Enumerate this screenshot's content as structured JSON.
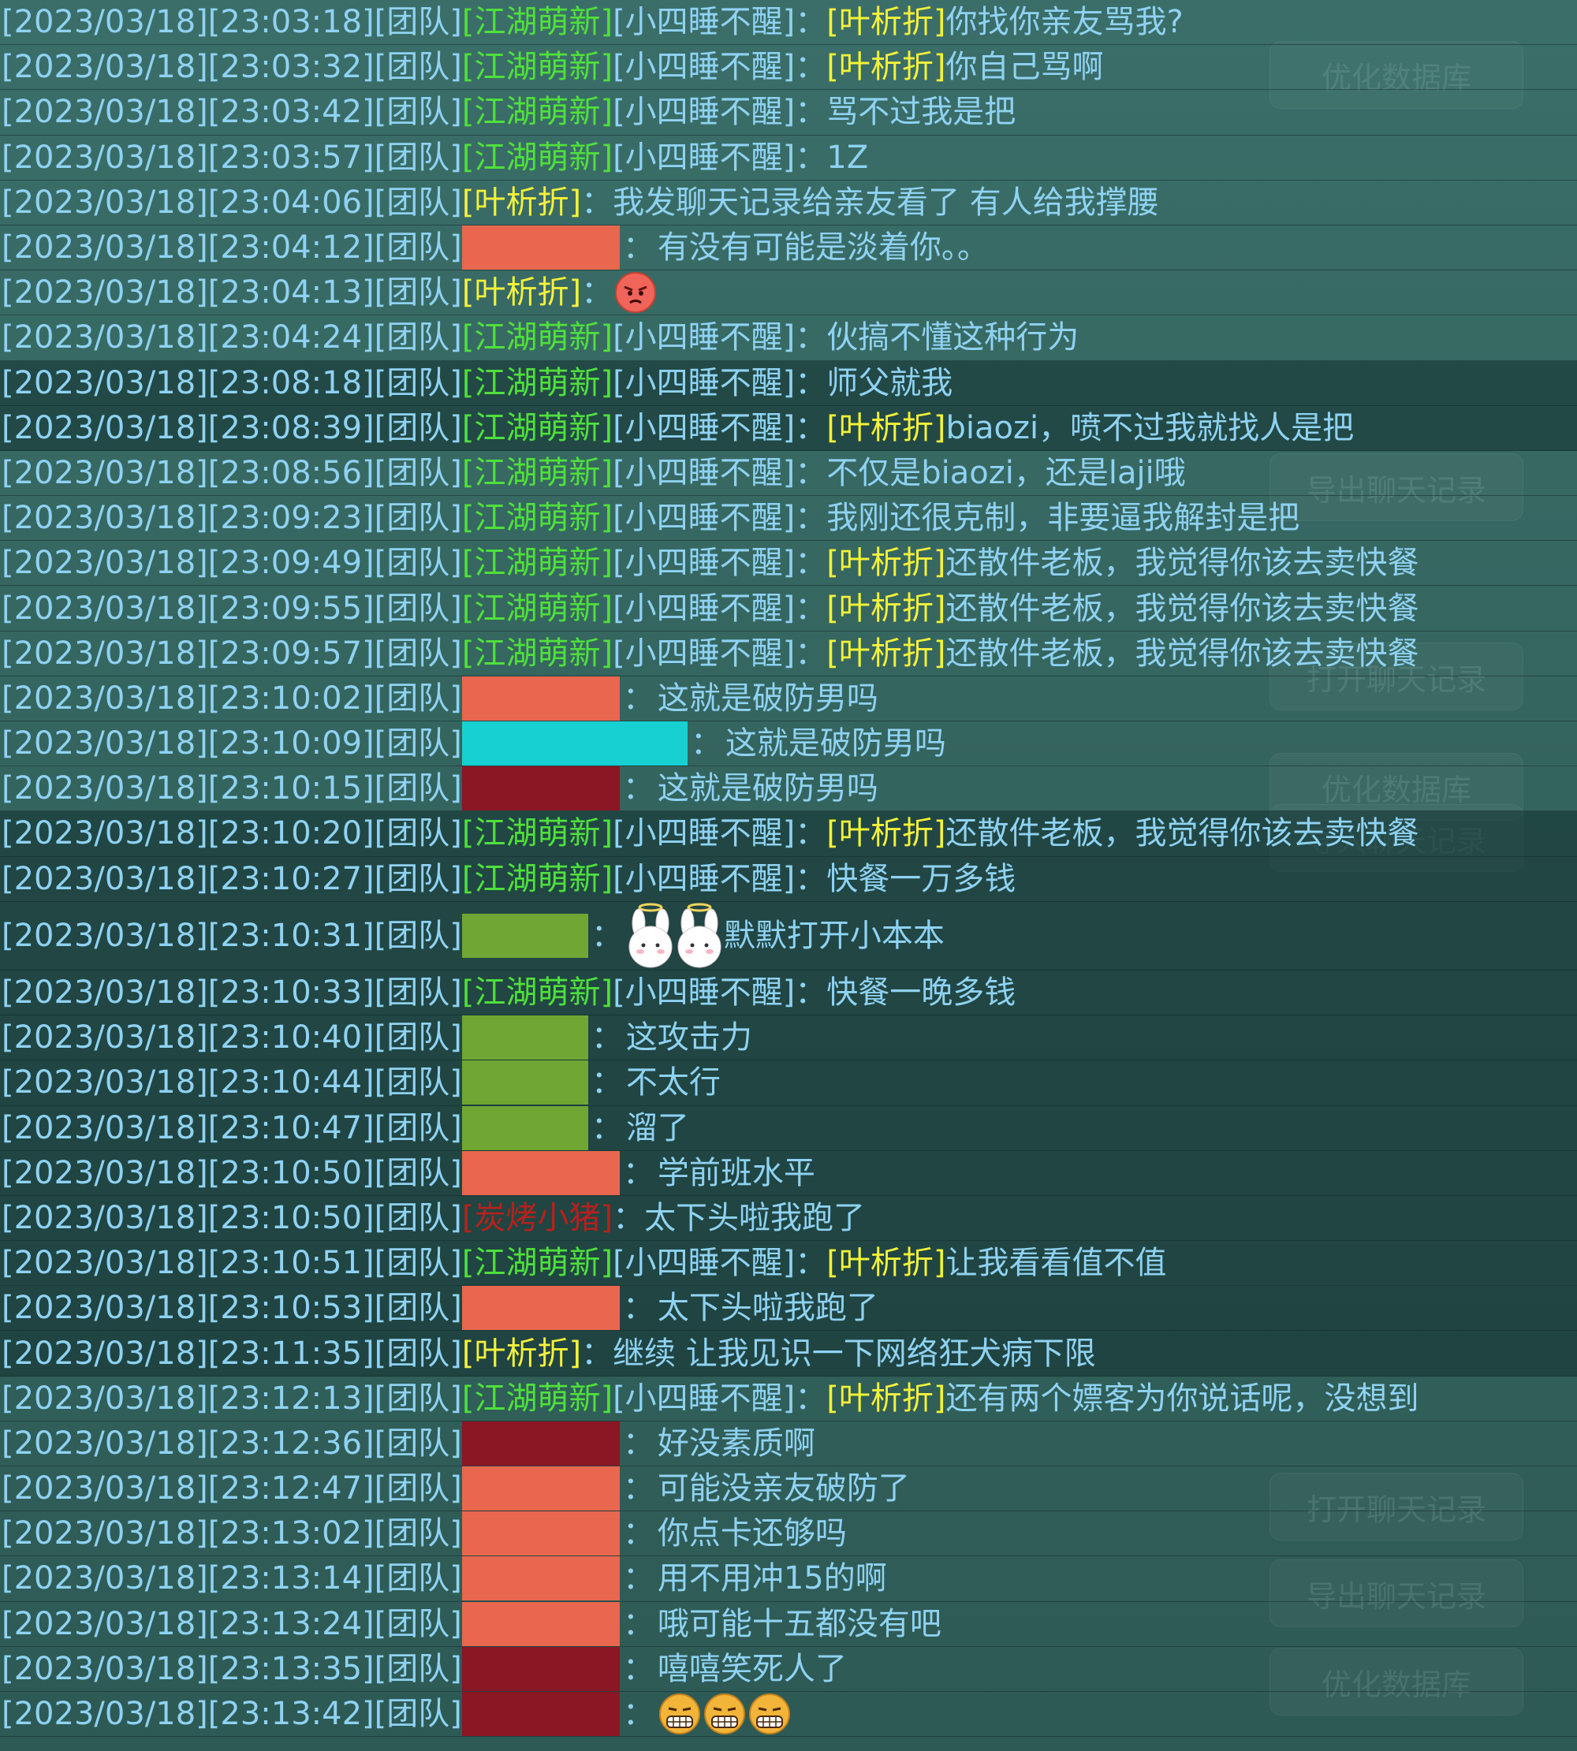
{
  "channel": "[团队]",
  "background_buttons": [
    "优化数据库",
    "导出聊天记录",
    "打开聊天记录",
    "优化数据库",
    "导入聊天记录",
    "打开聊天记录",
    "导出聊天记录",
    "优化数据库"
  ],
  "colors": {
    "text_blue": "#8fd2f2",
    "guild_green": "#4fe03c",
    "name_yellow": "#f3f23a",
    "name_red": "#b5211e",
    "redact_orange": "#e8674e",
    "redact_cyan": "#17d0d2",
    "redact_darkred": "#8b1624",
    "redact_green": "#6fa634"
  },
  "messages": [
    {
      "time": "[2023/03/18][23:03:18]",
      "guild": "[江湖萌新]",
      "sender": "[小四睡不醒]",
      "mention": "[叶析折]",
      "text": "你找你亲友骂我?"
    },
    {
      "time": "[2023/03/18][23:03:32]",
      "guild": "[江湖萌新]",
      "sender": "[小四睡不醒]",
      "mention": "[叶析折]",
      "text": "你自己骂啊"
    },
    {
      "time": "[2023/03/18][23:03:42]",
      "guild": "[江湖萌新]",
      "sender": "[小四睡不醒]",
      "text": "骂不过我是把"
    },
    {
      "time": "[2023/03/18][23:03:57]",
      "guild": "[江湖萌新]",
      "sender": "[小四睡不醒]",
      "text": "1Z"
    },
    {
      "time": "[2023/03/18][23:04:06]",
      "sender_yellow": "[叶析折]",
      "text": "我发聊天记录给亲友看了 有人给我撑腰"
    },
    {
      "time": "[2023/03/18][23:04:12]",
      "redacted": "orange",
      "text": "有没有可能是淡着你。。"
    },
    {
      "time": "[2023/03/18][23:04:13]",
      "sender_yellow": "[叶析折]",
      "emoji": "angry-face"
    },
    {
      "time": "[2023/03/18][23:04:24]",
      "guild": "[江湖萌新]",
      "sender": "[小四睡不醒]",
      "text": "伙搞不懂这种行为"
    },
    {
      "time": "[2023/03/18][23:08:18]",
      "guild": "[江湖萌新]",
      "sender": "[小四睡不醒]",
      "text": "师父就我",
      "dark": true
    },
    {
      "time": "[2023/03/18][23:08:39]",
      "guild": "[江湖萌新]",
      "sender": "[小四睡不醒]",
      "mention": "[叶析折]",
      "text": "biaozi，喷不过我就找人是把",
      "dark": true
    },
    {
      "time": "[2023/03/18][23:08:56]",
      "guild": "[江湖萌新]",
      "sender": "[小四睡不醒]",
      "text": "不仅是biaozi，还是laji哦"
    },
    {
      "time": "[2023/03/18][23:09:23]",
      "guild": "[江湖萌新]",
      "sender": "[小四睡不醒]",
      "text": "我刚还很克制，非要逼我解封是把"
    },
    {
      "time": "[2023/03/18][23:09:49]",
      "guild": "[江湖萌新]",
      "sender": "[小四睡不醒]",
      "mention": "[叶析折]",
      "text": "还散件老板，我觉得你该去卖快餐"
    },
    {
      "time": "[2023/03/18][23:09:55]",
      "guild": "[江湖萌新]",
      "sender": "[小四睡不醒]",
      "mention": "[叶析折]",
      "text": "还散件老板，我觉得你该去卖快餐"
    },
    {
      "time": "[2023/03/18][23:09:57]",
      "guild": "[江湖萌新]",
      "sender": "[小四睡不醒]",
      "mention": "[叶析折]",
      "text": "还散件老板，我觉得你该去卖快餐"
    },
    {
      "time": "[2023/03/18][23:10:02]",
      "redacted": "orange",
      "text": "这就是破防男吗"
    },
    {
      "time": "[2023/03/18][23:10:09]",
      "redacted": "cyan",
      "text": "这就是破防男吗"
    },
    {
      "time": "[2023/03/18][23:10:15]",
      "redacted": "darkred",
      "text": "这就是破防男吗"
    },
    {
      "time": "[2023/03/18][23:10:20]",
      "guild": "[江湖萌新]",
      "sender": "[小四睡不醒]",
      "mention": "[叶析折]",
      "text": "还散件老板，我觉得你该去卖快餐",
      "dark": true
    },
    {
      "time": "[2023/03/18][23:10:27]",
      "guild": "[江湖萌新]",
      "sender": "[小四睡不醒]",
      "text": "快餐一万多钱",
      "dark": true
    },
    {
      "time": "[2023/03/18][23:10:31]",
      "redacted": "green",
      "emoji": "bunny-pair",
      "text": "默默打开小本本",
      "dark": true
    },
    {
      "time": "[2023/03/18][23:10:33]",
      "guild": "[江湖萌新]",
      "sender": "[小四睡不醒]",
      "text": "快餐一晚多钱",
      "dark": true
    },
    {
      "time": "[2023/03/18][23:10:40]",
      "redacted": "green",
      "text": "这攻击力",
      "dark": true
    },
    {
      "time": "[2023/03/18][23:10:44]",
      "redacted": "green",
      "text": "不太行",
      "dark": true
    },
    {
      "time": "[2023/03/18][23:10:47]",
      "redacted": "green",
      "text": "溜了",
      "dark": true
    },
    {
      "time": "[2023/03/18][23:10:50]",
      "redacted": "orange",
      "text": "学前班水平",
      "dark": true
    },
    {
      "time": "[2023/03/18][23:10:50]",
      "sender_red": "[炭烤小猪]",
      "text": "太下头啦我跑了",
      "dark": true
    },
    {
      "time": "[2023/03/18][23:10:51]",
      "guild": "[江湖萌新]",
      "sender": "[小四睡不醒]",
      "mention": "[叶析折]",
      "text": "让我看看值不值",
      "dark": true
    },
    {
      "time": "[2023/03/18][23:10:53]",
      "redacted": "orange",
      "text": "太下头啦我跑了",
      "dark": true
    },
    {
      "time": "[2023/03/18][23:11:35]",
      "sender_yellow": "[叶析折]",
      "text": "继续 让我见识一下网络狂犬病下限",
      "dark": true
    },
    {
      "time": "[2023/03/18][23:12:13]",
      "guild": "[江湖萌新]",
      "sender": "[小四睡不醒]",
      "mention": "[叶析折]",
      "text": "还有两个嫖客为你说话呢，没想到"
    },
    {
      "time": "[2023/03/18][23:12:36]",
      "redacted": "darkred",
      "text": "好没素质啊"
    },
    {
      "time": "[2023/03/18][23:12:47]",
      "redacted": "orange",
      "text": "可能没亲友破防了"
    },
    {
      "time": "[2023/03/18][23:13:02]",
      "redacted": "orange",
      "text": "你点卡还够吗"
    },
    {
      "time": "[2023/03/18][23:13:14]",
      "redacted": "orange",
      "text": "用不用冲15的啊"
    },
    {
      "time": "[2023/03/18][23:13:24]",
      "redacted": "orange",
      "text": "哦可能十五都没有吧"
    },
    {
      "time": "[2023/03/18][23:13:35]",
      "redacted": "darkred",
      "text": "嘻嘻笑死人了"
    },
    {
      "time": "[2023/03/18][23:13:42]",
      "redacted": "darkred",
      "emoji": "grin-faces"
    }
  ]
}
